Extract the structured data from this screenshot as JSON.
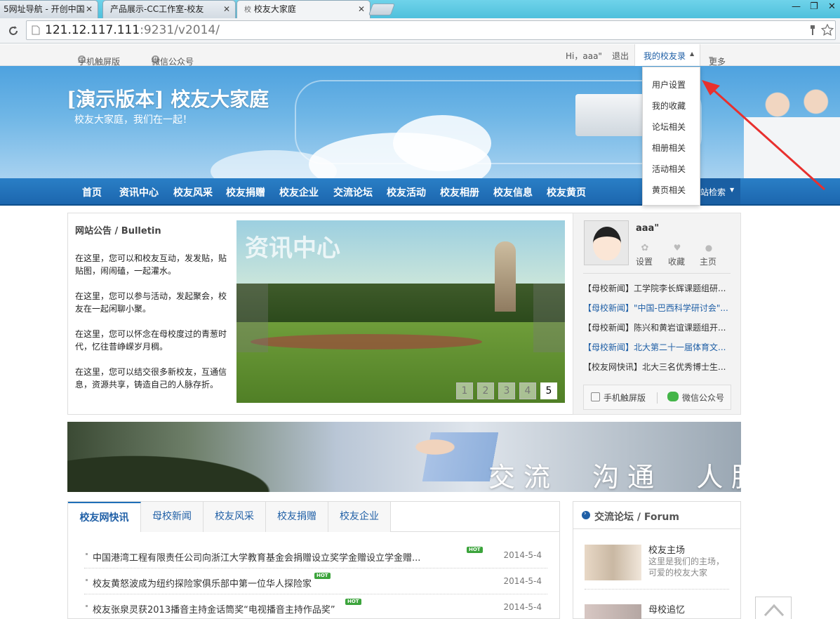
{
  "browser": {
    "tabs": [
      {
        "label": "5网址导航 - 开创中国"
      },
      {
        "label": "产品展示-CC工作室-校友"
      },
      {
        "label": "校友大家庭"
      }
    ],
    "tab_close": "✕",
    "address_host": "121.12.117.111",
    "address_rest": ":9231/v2014/",
    "window_controls": [
      "—",
      "❐",
      "✕"
    ]
  },
  "topbar": {
    "mobile": "手机触屏版",
    "wechat": "微信公众号",
    "greeting": "Hi，aaa\"",
    "logout": "退出",
    "my_profile": "我的校友录",
    "more": "更多"
  },
  "dropdown": {
    "items": [
      "用户设置",
      "我的收藏",
      "论坛相关",
      "相册相关",
      "活动相关",
      "黄页相关"
    ]
  },
  "banner": {
    "title": "[演示版本] 校友大家庭",
    "subtitle": "校友大家庭，我们在一起！"
  },
  "nav": {
    "items": [
      "首页",
      "资讯中心",
      "校友风采",
      "校友捐赠",
      "校友企业",
      "交流论坛",
      "校友活动",
      "校友相册",
      "校友信息",
      "校友黄页"
    ],
    "search": "站检索"
  },
  "bulletin": {
    "title": "网站公告 / Bulletin",
    "paragraphs": [
      "在这里，您可以和校友互动，发发贴，贴贴图，闹闹磕，一起灌水。",
      "在这里，您可以参与活动，发起聚会，校友在一起闲聊小聚。",
      "在这里，您可以怀念在母校度过的青葱时代，忆往昔峥嵘岁月稠。",
      "在这里，您可以结交很多新校友，互通信息，资源共享，铸造自己的人脉存折。"
    ]
  },
  "slider": {
    "caption": "资讯中心",
    "pages": [
      "1",
      "2",
      "3",
      "4",
      "5"
    ],
    "active_page": "5"
  },
  "user": {
    "name": "aaa\"",
    "settings": "设置",
    "favorites": "收藏",
    "home": "主页",
    "news": [
      "【母校新闻】工学院李长辉课题组研...",
      "【母校新闻】\"中国-巴西科学研讨会\"...",
      "【母校新闻】陈兴和黄岩谊课题组开...",
      "【母校新闻】北大第二十一届体育文...",
      "【校友网快讯】北大三名优秀博士生..."
    ],
    "mobile": "手机触屏版",
    "wechat": "微信公众号"
  },
  "banner2": {
    "slogan": "交流  沟通  人脉"
  },
  "tabs": {
    "items": [
      "校友网快讯",
      "母校新闻",
      "校友风采",
      "校友捐赠",
      "校友企业"
    ],
    "hot_label": "HOT",
    "rows": [
      {
        "title": "中国港湾工程有限责任公司向浙江大学教育基金会捐赠设立奖学金赠设立学金赠...",
        "date": "2014-5-4"
      },
      {
        "title": "校友黄怒波成为纽约探险家俱乐部中第一位华人探险家",
        "date": "2014-5-4"
      },
      {
        "title": "校友张泉灵获2013播音主持金话筒奖“电视播音主持作品奖”",
        "date": "2014-5-4"
      }
    ]
  },
  "forum": {
    "title": "交流论坛 / Forum",
    "items": [
      {
        "name": "校友主场",
        "desc1": "这里是我们的主场，",
        "desc2": "可爱的校友大家"
      },
      {
        "name": "母校追忆",
        "desc1": "",
        "desc2": ""
      }
    ]
  },
  "colors": {
    "nav": "#1f6fb8",
    "link": "#1f5fa6",
    "hot": "#3ca43c",
    "arrow": "#e8302e"
  }
}
